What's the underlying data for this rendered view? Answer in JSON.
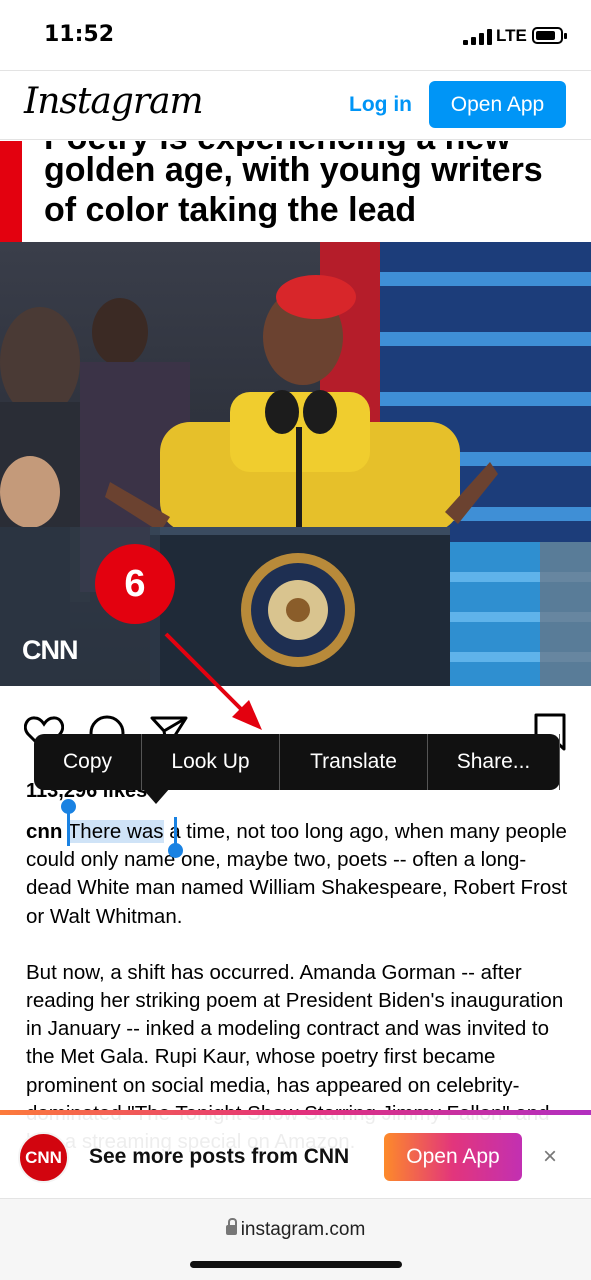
{
  "status_bar": {
    "time": "11:52",
    "network": "LTE"
  },
  "header": {
    "logo": "Instagram",
    "login_label": "Log in",
    "open_app_label": "Open App"
  },
  "headline": {
    "cut_line": "Poetry is experiencing a new",
    "line1": "golden age, with young writers",
    "line2": "of color taking the lead"
  },
  "photo": {
    "watermark": "CNN"
  },
  "post": {
    "likes": "113,296 likes",
    "username": "cnn",
    "selected_text": "There was",
    "para1_rest": " a time, not too long ago, when many people could only name one, maybe two, poets -- often a long-dead White man named William Shakespeare, Robert Frost or Walt Whitman.",
    "para2": "But now, a shift has occurred. Amanda Gorman -- after reading her striking poem at President Biden's inauguration in January -- inked a modeling contract and was invited to the Met Gala. Rupi Kaur, whose poetry first became prominent on social media, has appeared on celebrity-dominated \"The Tonight Show Starring Jimmy Fallon\" and has a streaming special on Amazon."
  },
  "context_menu": {
    "items": [
      "Copy",
      "Look Up",
      "Translate",
      "Share..."
    ]
  },
  "annotation": {
    "step": "6"
  },
  "banner": {
    "logo": "CNN",
    "text": "See more posts from CNN",
    "open_app_label": "Open App",
    "close": "×"
  },
  "footer": {
    "url": "instagram.com"
  },
  "colors": {
    "accent": "#0095f6",
    "cnn_red": "#e3010f",
    "selection": "#cfe3f7"
  }
}
